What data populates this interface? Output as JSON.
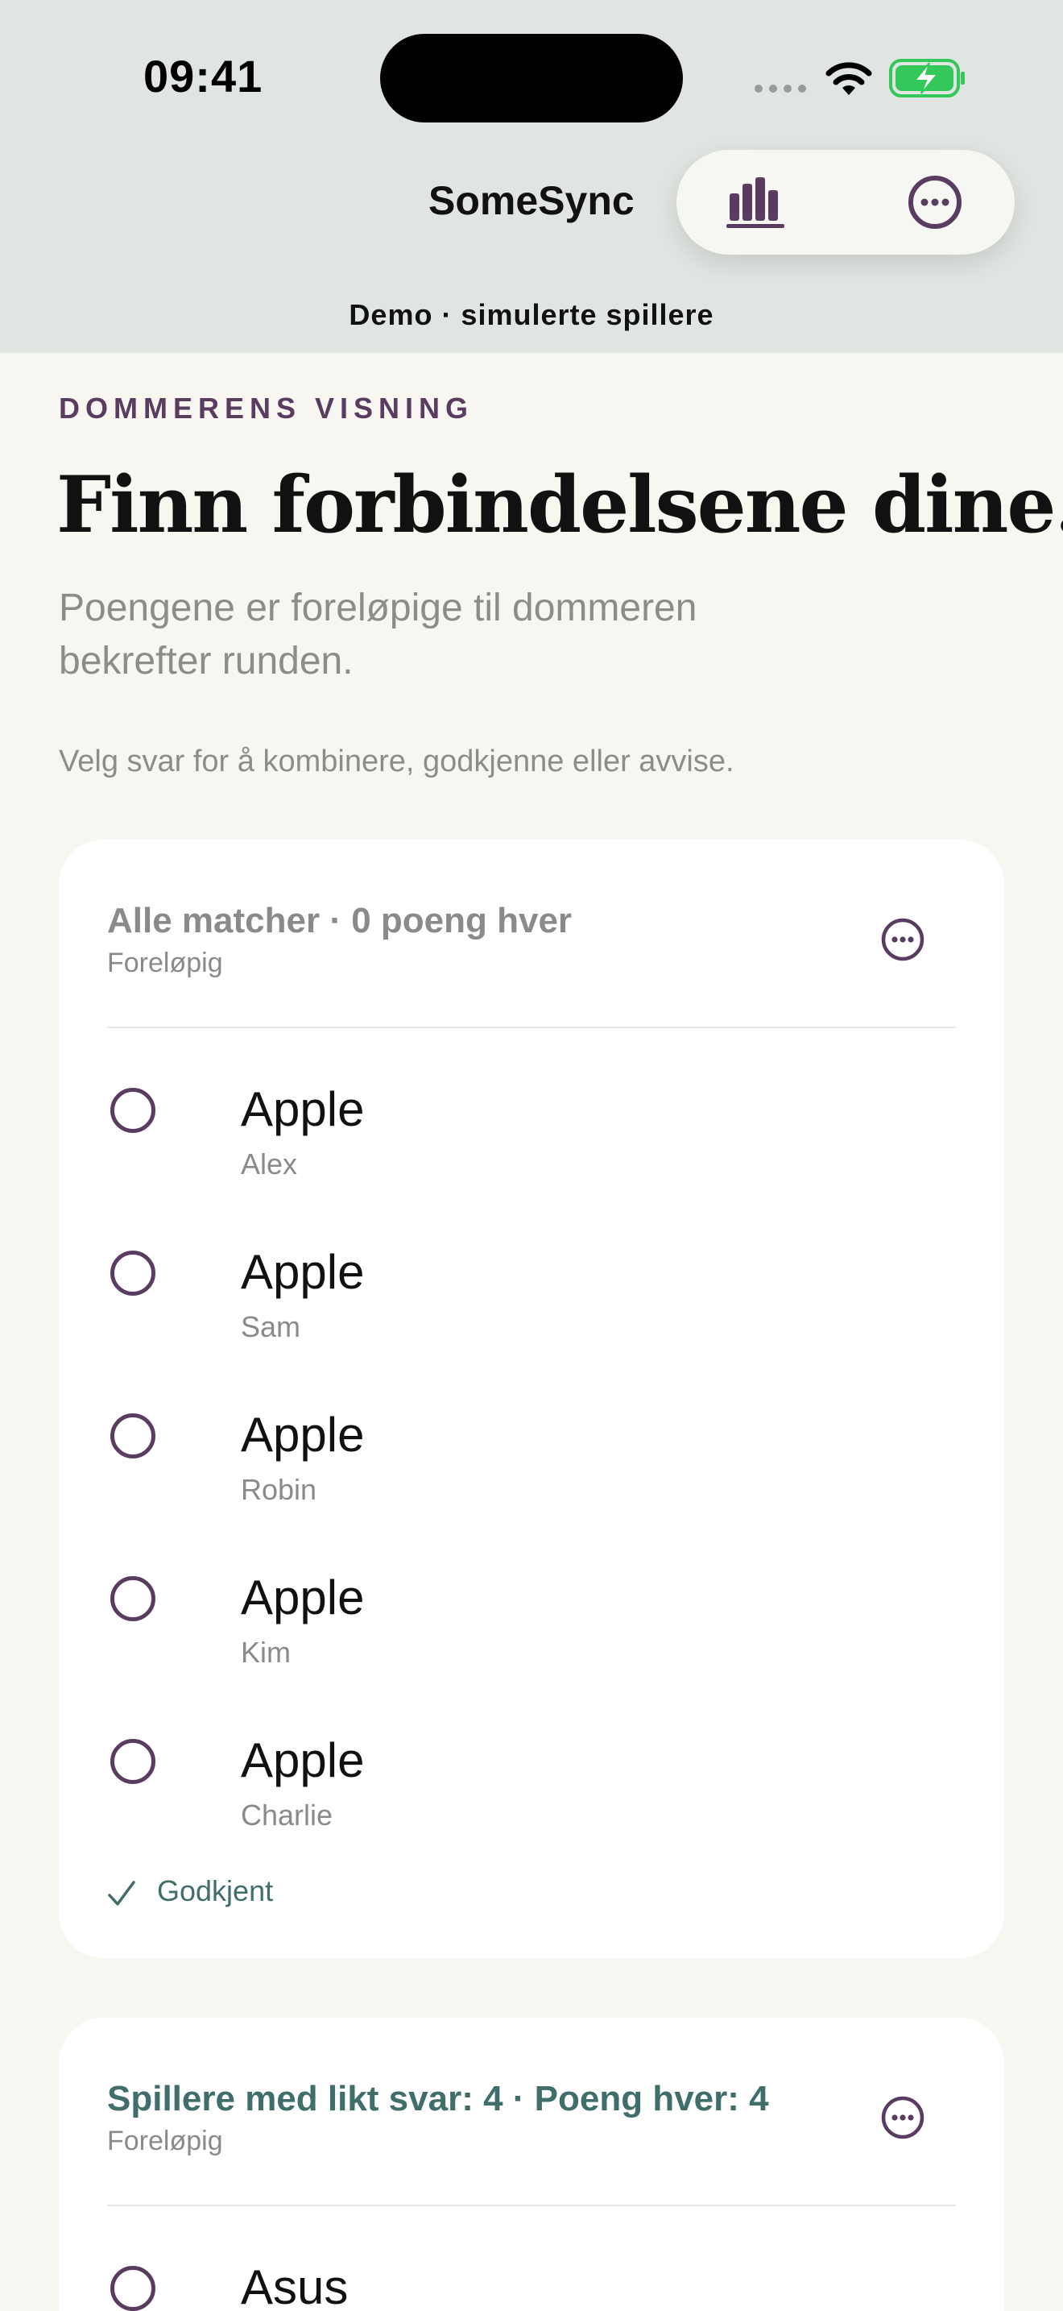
{
  "status_bar": {
    "time": "09:41"
  },
  "header": {
    "app_title": "SomeSync",
    "stats_icon": "bar-chart-icon",
    "more_icon": "ellipsis-circle-icon",
    "demo_banner": "Demo · simulerte spillere"
  },
  "intro": {
    "eyebrow": "DOMMERENS VISNING",
    "headline": "Finn forbindelsene dine.",
    "lede": "Poengene er foreløpige til dommeren bekrefter runden.",
    "hint": "Velg svar for å kombinere, godkjenne eller avvise."
  },
  "groups": [
    {
      "title": "Alle matcher · 0 poeng hver",
      "status": "Foreløpig",
      "answers": [
        {
          "text": "Apple",
          "player": "Alex"
        },
        {
          "text": "Apple",
          "player": "Sam"
        },
        {
          "text": "Apple",
          "player": "Robin"
        },
        {
          "text": "Apple",
          "player": "Kim"
        },
        {
          "text": "Apple",
          "player": "Charlie"
        }
      ],
      "approved_label": "Godkjent"
    },
    {
      "title": "Spillere med likt svar: 4 · Poeng hver: 4",
      "status": "Foreløpig",
      "answers": [
        {
          "text": "Asus",
          "player": ""
        }
      ]
    }
  ],
  "colors": {
    "header_bg": "#e1e5e1",
    "page_bg": "#f8f6f0",
    "accent_purple": "#5a3c61",
    "accent_teal": "#3f6e6b",
    "battery_green": "#34c759"
  }
}
